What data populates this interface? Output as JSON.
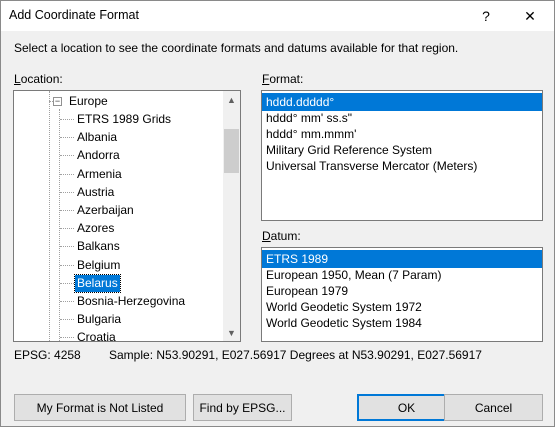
{
  "window": {
    "title": "Add Coordinate Format",
    "help_glyph": "?",
    "close_glyph": "✕"
  },
  "intro_text": "Select a location to see the coordinate formats and datums available for that region.",
  "location": {
    "label_hotkey": "L",
    "label_rest": "ocation:",
    "tree": {
      "parent": {
        "label": "Europe",
        "expander": "−"
      },
      "children": [
        "ETRS 1989 Grids",
        "Albania",
        "Andorra",
        "Armenia",
        "Austria",
        "Azerbaijan",
        "Azores",
        "Balkans",
        "Belgium",
        "Belarus",
        "Bosnia-Herzegovina",
        "Bulgaria",
        "Croatia"
      ],
      "selected": "Belarus"
    },
    "scroll_up": "▲",
    "scroll_down": "▼"
  },
  "format": {
    "label_hotkey": "F",
    "label_rest": "ormat:",
    "items": [
      "hddd.ddddd°",
      "hddd° mm' ss.s\"",
      "hddd° mm.mmm'",
      "Military Grid Reference System",
      "Universal Transverse Mercator (Meters)"
    ],
    "selected_index": 0
  },
  "datum": {
    "label_hotkey": "D",
    "label_rest": "atum:",
    "items": [
      "ETRS 1989",
      "European 1950, Mean (7 Param)",
      "European 1979",
      "World Geodetic System 1972",
      "World Geodetic System 1984"
    ],
    "selected_index": 0
  },
  "status": {
    "epsg": "EPSG: 4258",
    "sample": "Sample: N53.90291, E027.56917 Degrees at N53.90291, E027.56917"
  },
  "buttons": {
    "not_listed": "My Format is Not Listed",
    "find_epsg": "Find by EPSG...",
    "ok": "OK",
    "cancel": "Cancel"
  },
  "colors": {
    "selection": "#0078d7",
    "dialog_bg": "#f0f0f0"
  }
}
